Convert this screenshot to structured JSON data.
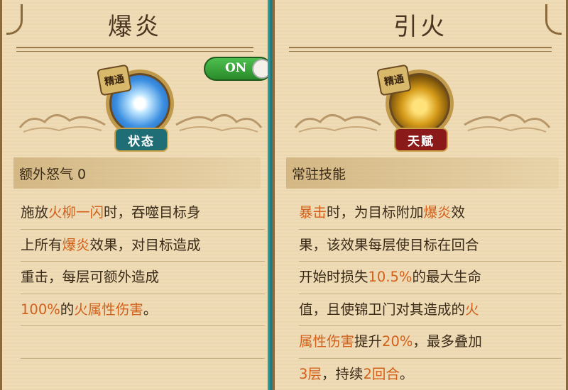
{
  "colors": {
    "highlight": "#d2601a",
    "text": "#3a2a18",
    "panel": "#efdcb6"
  },
  "left_card": {
    "title": "爆炎",
    "badge_top": "精通",
    "badge_bottom": "状态",
    "icon": "blue-burst-orb-icon",
    "toggle_label": "ON",
    "toggle_state": "on",
    "subtitle": "额外怒气 0",
    "description": [
      [
        {
          "t": "施放",
          "hl": false
        },
        {
          "t": "火柳一闪",
          "hl": true
        },
        {
          "t": "时，吞噬目标身",
          "hl": false
        }
      ],
      [
        {
          "t": "上所有",
          "hl": false
        },
        {
          "t": "爆炎",
          "hl": true
        },
        {
          "t": "效果，对目标造成",
          "hl": false
        }
      ],
      [
        {
          "t": "重击，每层可额外造成",
          "hl": false
        }
      ],
      [
        {
          "t": "100%",
          "hl": true
        },
        {
          "t": "的",
          "hl": false
        },
        {
          "t": "火属性伤害",
          "hl": true
        },
        {
          "t": "。",
          "hl": false
        }
      ],
      [],
      []
    ]
  },
  "right_card": {
    "title": "引火",
    "badge_top": "精通",
    "badge_bottom": "天赋",
    "icon": "golden-fire-warrior-icon",
    "subtitle": "常驻技能",
    "description": [
      [
        {
          "t": "暴击",
          "hl": true
        },
        {
          "t": "时，为目标附加",
          "hl": false
        },
        {
          "t": "爆炎",
          "hl": true
        },
        {
          "t": "效",
          "hl": false
        }
      ],
      [
        {
          "t": "果，该效果每层使目标在回合",
          "hl": false
        }
      ],
      [
        {
          "t": "开始时损失",
          "hl": false
        },
        {
          "t": "10.5%",
          "hl": true
        },
        {
          "t": "的最大生命",
          "hl": false
        }
      ],
      [
        {
          "t": "值，且使锦卫门对其造成的",
          "hl": false
        },
        {
          "t": "火",
          "hl": true
        }
      ],
      [
        {
          "t": "属性伤害",
          "hl": true
        },
        {
          "t": "提升",
          "hl": false
        },
        {
          "t": "20%",
          "hl": true
        },
        {
          "t": "，最多叠加",
          "hl": false
        }
      ],
      [
        {
          "t": "3层",
          "hl": true
        },
        {
          "t": "，持续",
          "hl": false
        },
        {
          "t": "2回合",
          "hl": true
        },
        {
          "t": "。",
          "hl": false
        }
      ]
    ]
  }
}
